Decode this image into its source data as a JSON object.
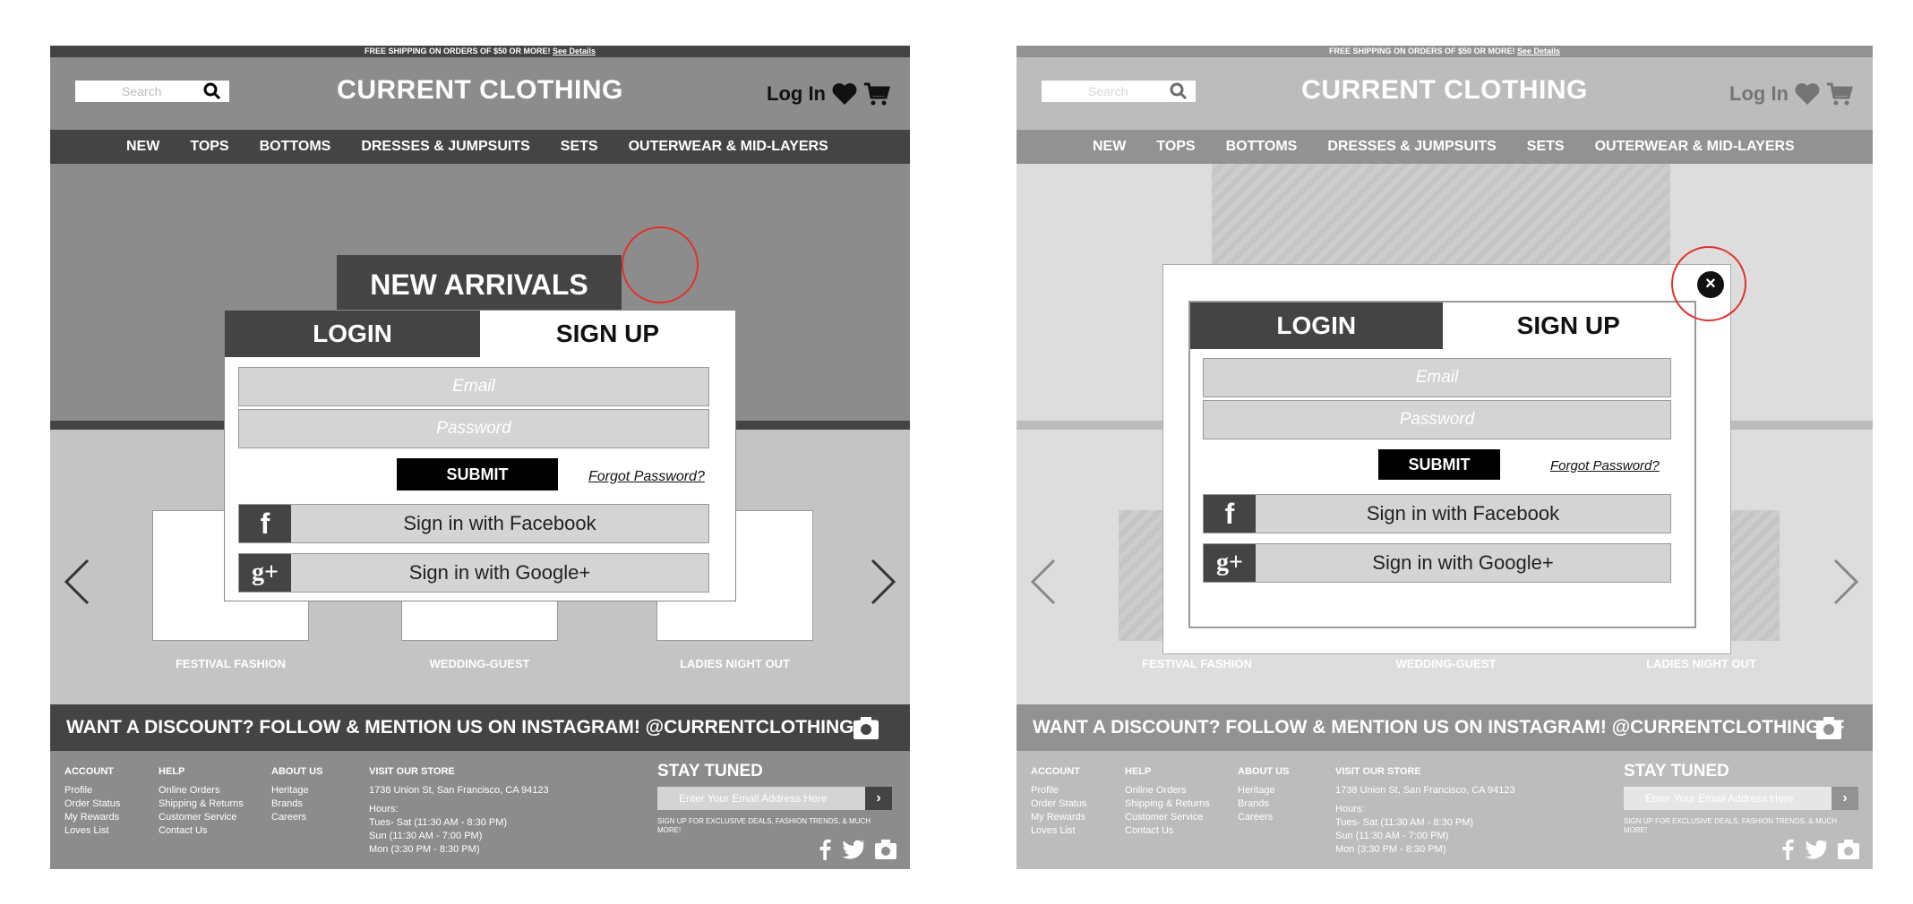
{
  "topbar": {
    "text": "FREE SHIPPING ON ORDERS OF $50 OR MORE!",
    "link": "See Details"
  },
  "search": {
    "placeholder": "Search"
  },
  "brand": "CURRENT CLOTHING",
  "header": {
    "login": "Log In"
  },
  "nav": [
    "NEW",
    "TOPS",
    "BOTTOMS",
    "DRESSES & JUMPSUITS",
    "SETS",
    "OUTERWEAR & MID-LAYERS"
  ],
  "hero": {
    "banner": "NEW ARRIVALS"
  },
  "carousel": {
    "labels": [
      "FESTIVAL FASHION",
      "WEDDING-GUEST",
      "LADIES NIGHT OUT"
    ]
  },
  "modal": {
    "tab_login": "LOGIN",
    "tab_signup": "SIGN UP",
    "email_placeholder": "Email",
    "password_placeholder": "Password",
    "submit": "SUBMIT",
    "forgot": "Forgot Password?",
    "facebook": "Sign in with Facebook",
    "google": "Sign in with Google+"
  },
  "instagram": "WANT A DISCOUNT? FOLLOW & MENTION US ON INSTAGRAM! @CURRENTCLOTHINGSF",
  "footer": {
    "account": {
      "title": "ACCOUNT",
      "items": [
        "Profile",
        "Order Status",
        "My Rewards",
        "Loves List"
      ]
    },
    "help": {
      "title": "HELP",
      "items": [
        "Online Orders",
        "Shipping & Returns",
        "Customer Service",
        "Contact Us"
      ]
    },
    "about": {
      "title": "ABOUT US",
      "items": [
        "Heritage",
        "Brands",
        "Careers"
      ]
    },
    "store": {
      "title": "VISIT OUR STORE",
      "address": "1738 Union St, San Francisco, CA 94123",
      "hours_label": "Hours:",
      "hours": [
        "Tues- Sat (11:30 AM - 8:30 PM)",
        "Sun (11:30 AM - 7:00 PM)",
        "Mon (3:30 PM - 8:30 PM)"
      ]
    },
    "stay": {
      "title": "STAY TUNED",
      "email_placeholder": "Enter Your Email Address Here",
      "note": "SIGN UP FOR EXCLUSIVE DEALS, FASHION TRENDS, & MUCH MORE!"
    }
  },
  "colors": {
    "dark": "#444444",
    "mid": "#8c8c8c",
    "light": "#c4c4c4",
    "annotation": "#e0322a"
  }
}
